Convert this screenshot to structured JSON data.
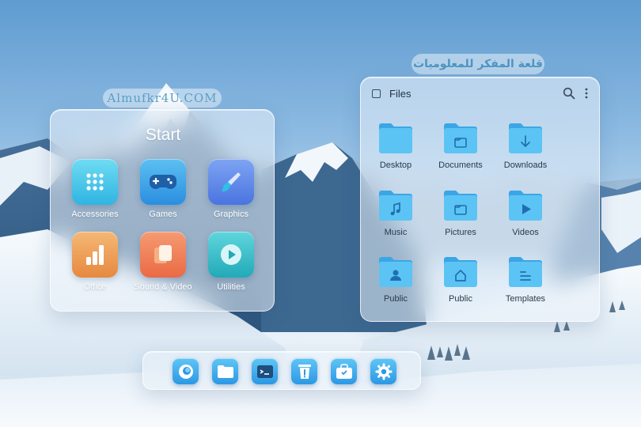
{
  "watermark": {
    "latin": "Almufkr4U.COM",
    "arabic": "قلعة المفكر للمعلوميات"
  },
  "start_menu": {
    "title": "Start",
    "apps": [
      {
        "label": "Accessories",
        "icon": "grid-icon",
        "color": "#3fc6e8"
      },
      {
        "label": "Games",
        "icon": "gamepad-icon",
        "color": "#3a9fe0"
      },
      {
        "label": "Graphics",
        "icon": "brush-icon",
        "color": "#5a7fe6"
      },
      {
        "label": "Office",
        "icon": "bar-chart-icon",
        "color": "#f0a25a"
      },
      {
        "label": "Sound & Video",
        "icon": "media-icon",
        "color": "#f07a56"
      },
      {
        "label": "Utilities",
        "icon": "play-icon",
        "color": "#2ec0c8"
      }
    ]
  },
  "file_manager": {
    "title": "Files",
    "folders": [
      {
        "label": "Desktop",
        "icon": "folder-icon"
      },
      {
        "label": "Documents",
        "icon": "folder-documents-icon"
      },
      {
        "label": "Downloads",
        "icon": "folder-downloads-icon"
      },
      {
        "label": "Music",
        "icon": "folder-music-icon"
      },
      {
        "label": "Pictures",
        "icon": "folder-pictures-icon"
      },
      {
        "label": "Videos",
        "icon": "folder-videos-icon"
      },
      {
        "label": "Public",
        "icon": "folder-public-user-icon"
      },
      {
        "label": "Public",
        "icon": "folder-home-icon"
      },
      {
        "label": "Templates",
        "icon": "folder-templates-icon"
      }
    ]
  },
  "dock": {
    "items": [
      "browser-icon",
      "files-icon",
      "terminal-icon",
      "trash-icon",
      "store-icon",
      "settings-icon"
    ]
  },
  "colors": {
    "folder": "#5cc4f4",
    "folder_tab": "#3aa6e6",
    "dock_blue": "#2c98e4"
  }
}
